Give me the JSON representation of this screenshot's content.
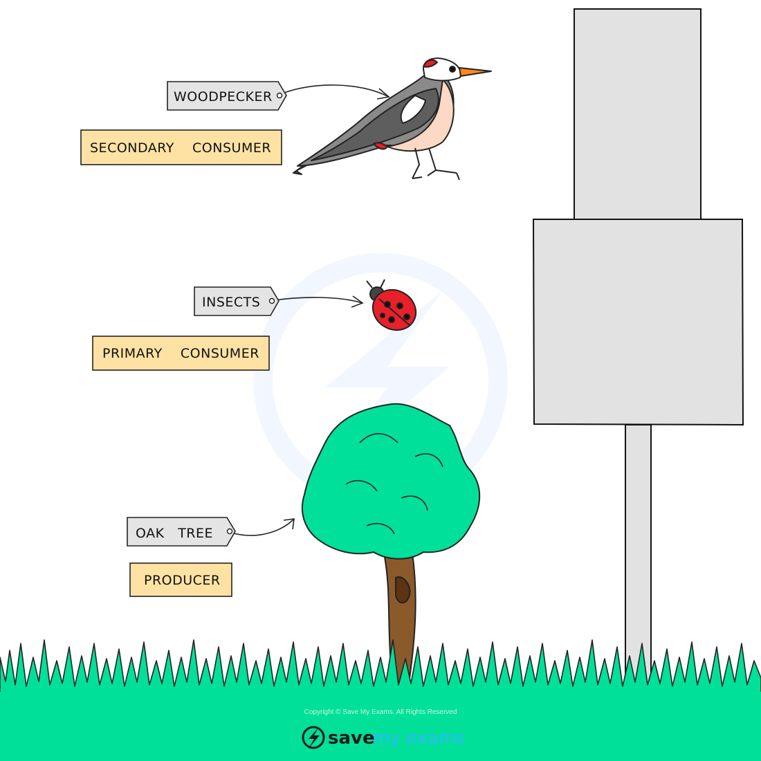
{
  "tags": {
    "woodpecker": "WOODPECKER",
    "insects": "INSECTS",
    "oak_tree": "OAK   TREE"
  },
  "levels": {
    "secondary": "SECONDARY    CONSUMER",
    "primary": "PRIMARY    CONSUMER",
    "producer": "PRODUCER"
  },
  "pyramid": {
    "tiers": 2,
    "fill": "#e2e2e2"
  },
  "footer": {
    "copyright": "Copyright © Save My Exams. All Rights Reserved",
    "brand_save": "save",
    "brand_rest": "my exams"
  },
  "colors": {
    "tag_fill": "#e4e4e4",
    "label_fill": "#fde2a4",
    "grass": "#00e098",
    "tree_crown": "#00e09a",
    "trunk": "#8b5a2b",
    "ladybird": "#e8202a"
  },
  "icons": [
    "woodpecker-icon",
    "ladybird-icon",
    "oak-tree-icon",
    "grass",
    "logo-bolt-icon"
  ]
}
